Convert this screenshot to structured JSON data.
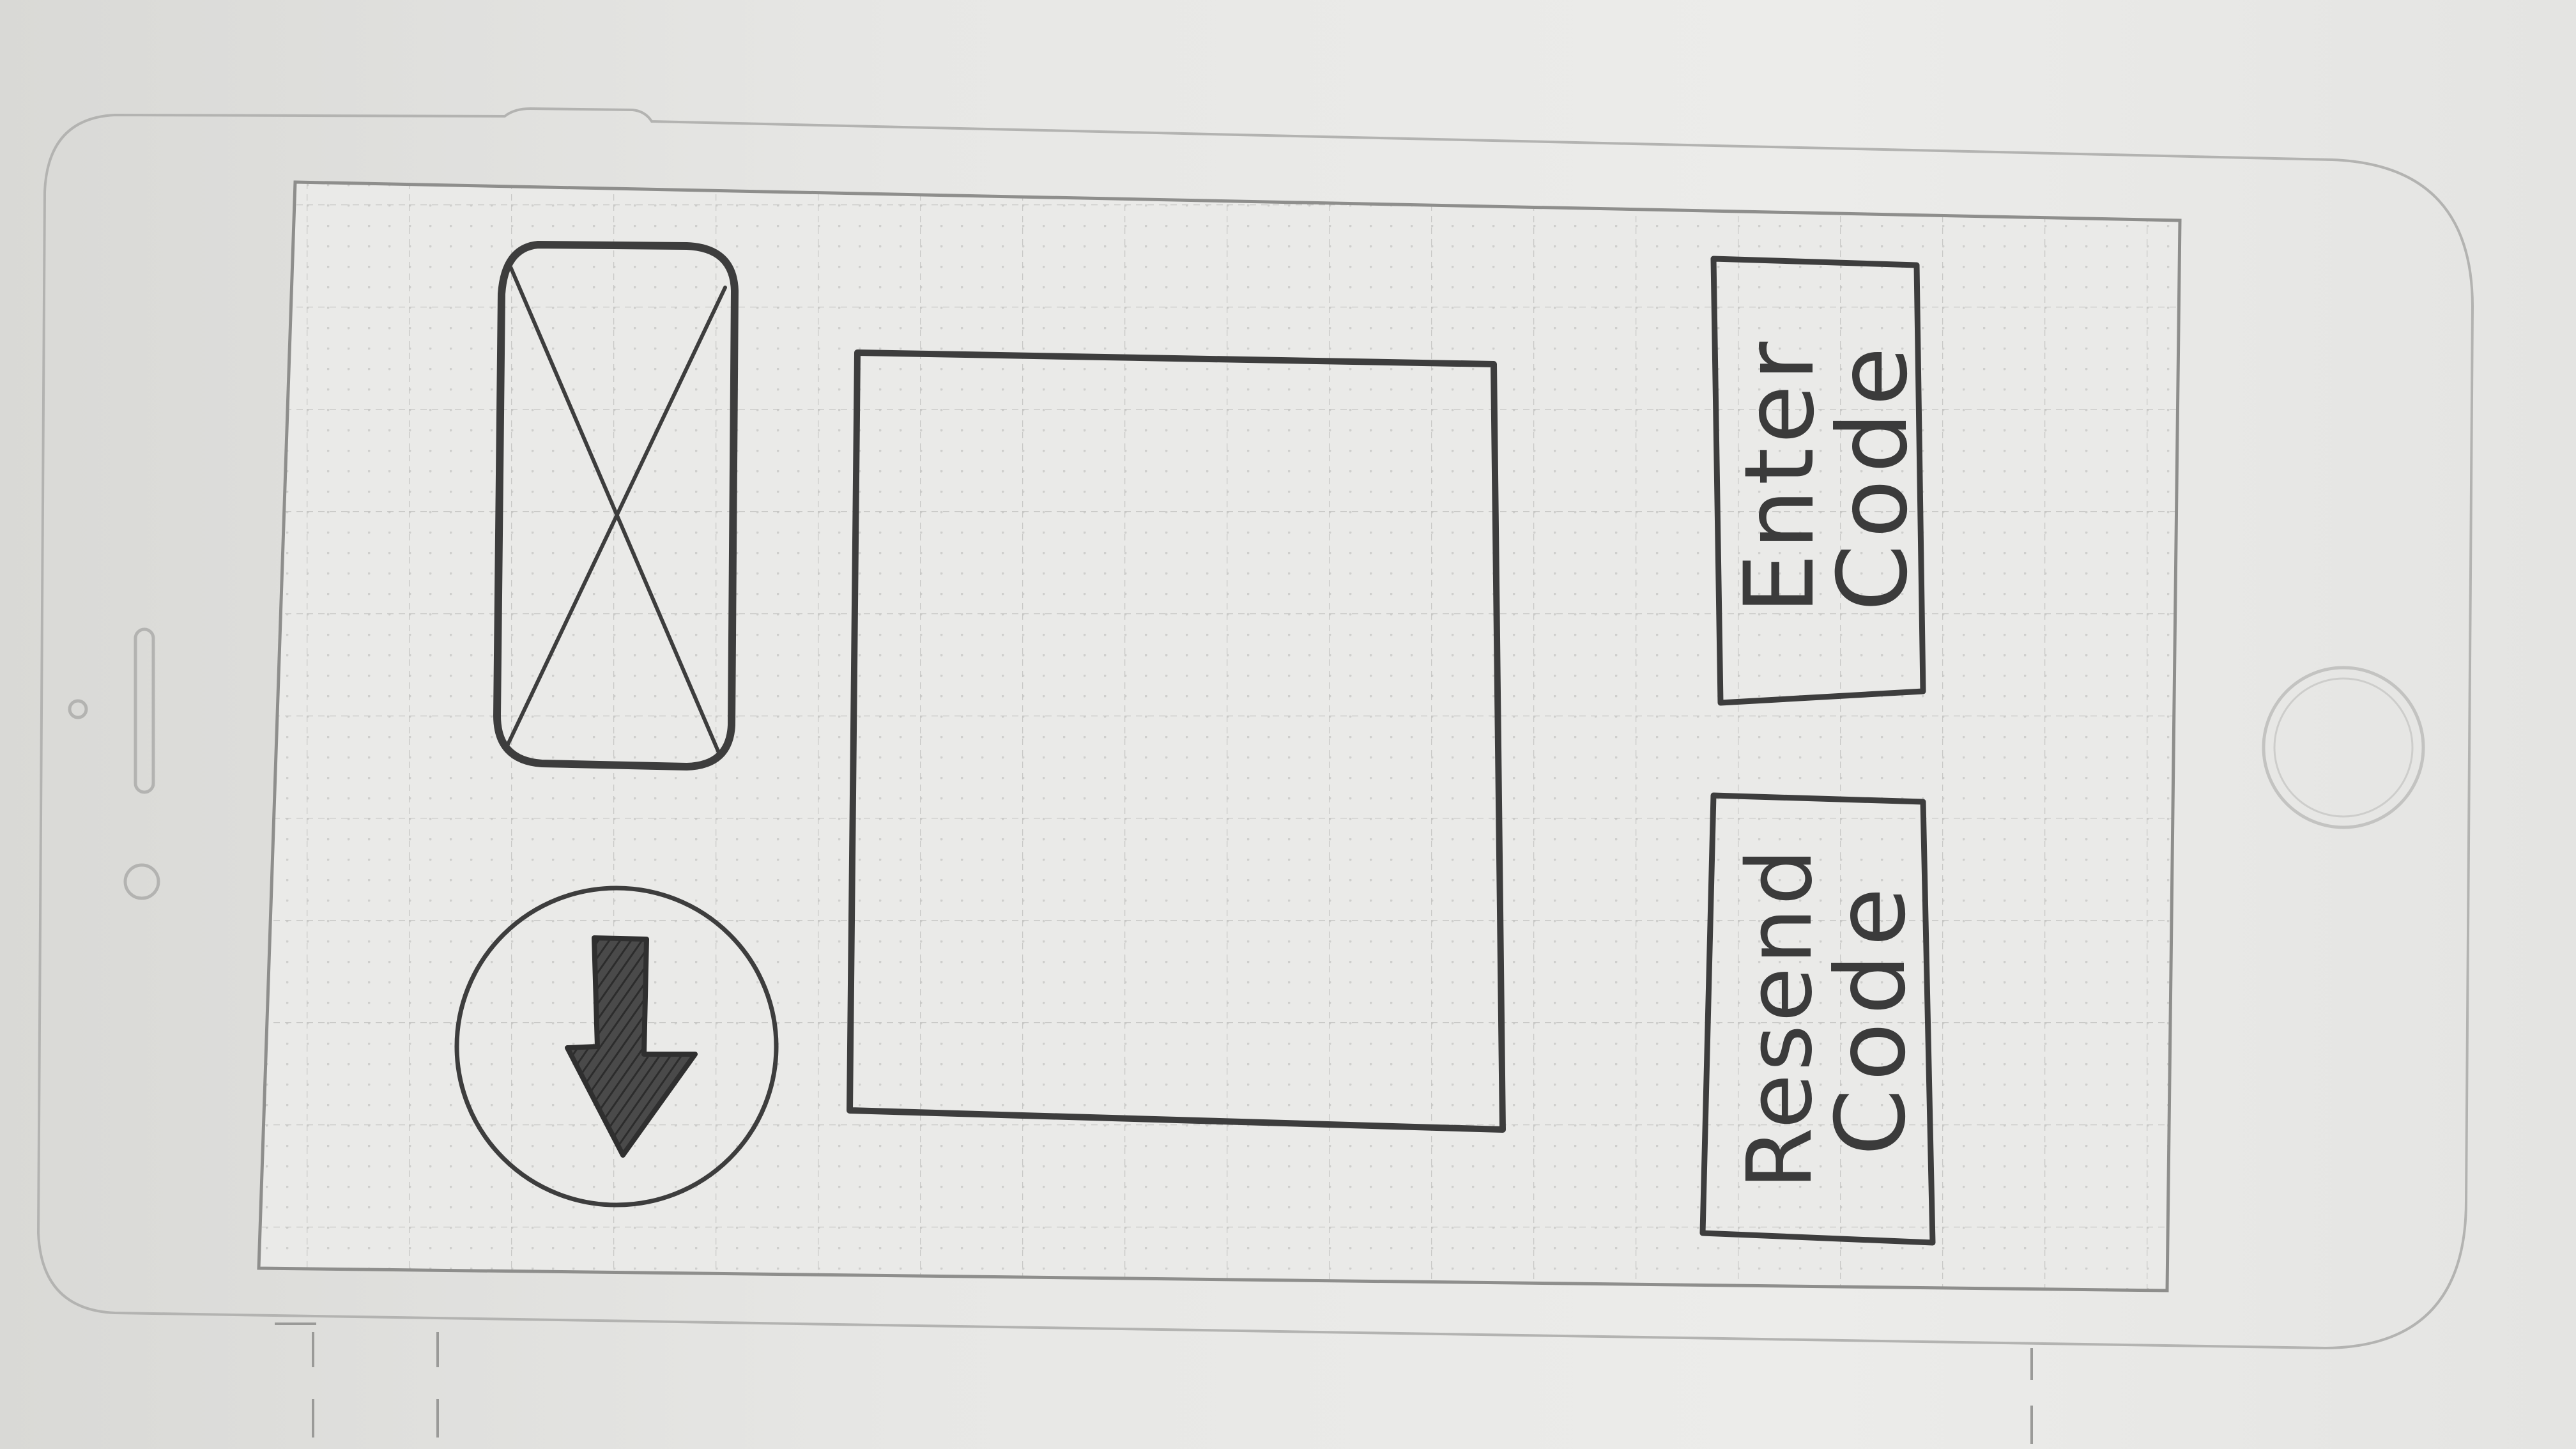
{
  "wireframe": {
    "device": "phone-landscape-sketch",
    "image_placeholder": {
      "icon": "crossed-box-image-icon"
    },
    "download_control": {
      "icon": "down-arrow-icon"
    },
    "code_display": {
      "value": ""
    },
    "buttons": {
      "enter_code": {
        "line1": "Enter",
        "line2": "Code"
      },
      "resend_code": {
        "line1": "Resend",
        "line2": "Code"
      }
    },
    "colors": {
      "pencil": "#3b3b3b",
      "phone_outline": "#b8b8b6",
      "grid": "#c8c8c6",
      "paper": "#e8e8e6"
    }
  }
}
